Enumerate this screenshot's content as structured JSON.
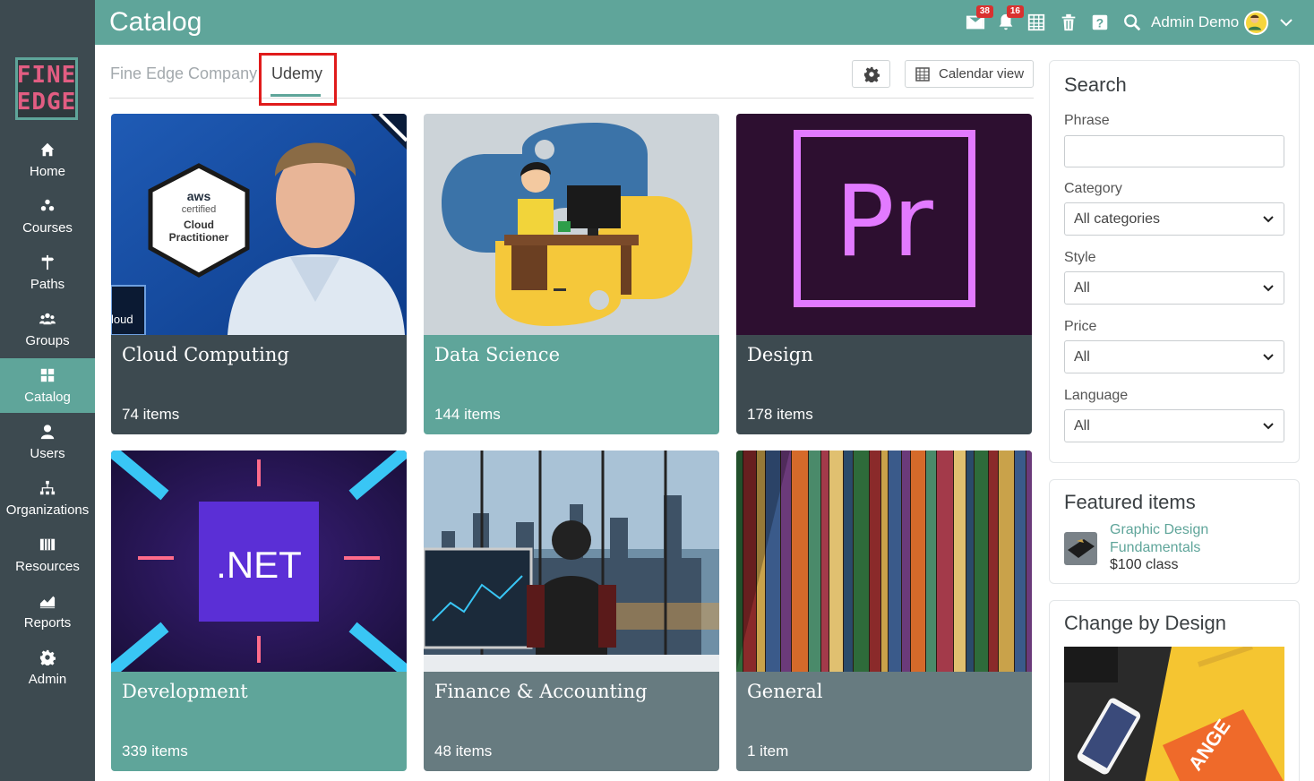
{
  "header": {
    "title": "Catalog",
    "user_name": "Admin Demo",
    "messages_count": "38",
    "notifications_count": "16",
    "icons": [
      "envelope-icon",
      "bell-icon",
      "calendar-icon",
      "trash-icon",
      "help-icon",
      "search-icon",
      "chevron-down-icon"
    ]
  },
  "logo": {
    "line1": "FINE",
    "line2": "EDGE"
  },
  "sidebar": {
    "items": [
      {
        "label": "Home",
        "icon": "home-icon"
      },
      {
        "label": "Courses",
        "icon": "courses-icon"
      },
      {
        "label": "Paths",
        "icon": "paths-icon"
      },
      {
        "label": "Groups",
        "icon": "groups-icon"
      },
      {
        "label": "Catalog",
        "icon": "catalog-icon",
        "active": true
      },
      {
        "label": "Users",
        "icon": "user-icon"
      },
      {
        "label": "Organizations",
        "icon": "organizations-icon"
      },
      {
        "label": "Resources",
        "icon": "resources-icon"
      },
      {
        "label": "Reports",
        "icon": "reports-icon"
      },
      {
        "label": "Admin",
        "icon": "gear-icon"
      }
    ]
  },
  "tabs": [
    {
      "label": "Fine Edge Company",
      "active": false
    },
    {
      "label": "Udemy",
      "active": true
    }
  ],
  "toolbar": {
    "calendar_label": "Calendar view"
  },
  "categories": [
    {
      "title": "Cloud Computing",
      "count": "74 items",
      "badge_line1": "aws",
      "badge_line2": "certified",
      "badge_line3": "Cloud",
      "badge_line4": "Practitioner",
      "corner_text": "loud"
    },
    {
      "title": "Data Science",
      "count": "144 items"
    },
    {
      "title": "Design",
      "count": "178 items",
      "logo_text": "Pr"
    },
    {
      "title": "Development",
      "count": "339 items",
      "logo_text": ".NET"
    },
    {
      "title": "Finance & Accounting",
      "count": "48 items"
    },
    {
      "title": "General",
      "count": "1 item"
    }
  ],
  "search_panel": {
    "title": "Search",
    "phrase_label": "Phrase",
    "phrase_value": "",
    "category_label": "Category",
    "category_value": "All categories",
    "style_label": "Style",
    "style_value": "All",
    "price_label": "Price",
    "price_value": "All",
    "language_label": "Language",
    "language_value": "All"
  },
  "featured": {
    "title": "Featured items",
    "item_title": "Graphic Design Fundamentals",
    "item_price": "$100 class"
  },
  "change_by_design": {
    "title": "Change by Design",
    "cover_text": "ANGE"
  },
  "colors": {
    "primary": "#5fa59a",
    "sidebar": "#3d4a50",
    "badge": "#d9312f",
    "highlight": "#e01b1b"
  }
}
